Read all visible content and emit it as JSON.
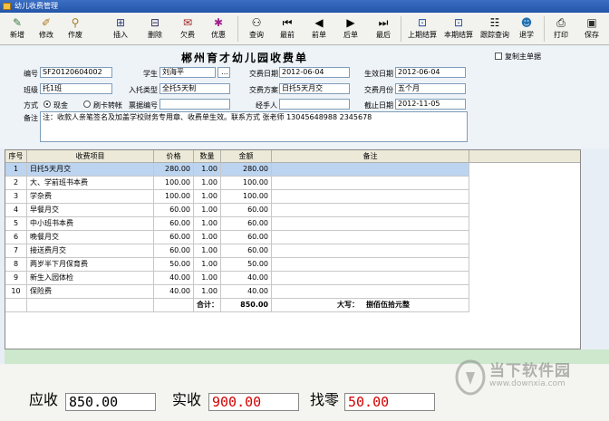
{
  "window": {
    "title": "幼儿收费管理"
  },
  "toolbar": {
    "items": [
      {
        "label": "新增",
        "icon": "new-icon"
      },
      {
        "label": "修改",
        "icon": "edit-icon"
      },
      {
        "label": "作废",
        "icon": "void-icon"
      },
      {
        "label": "插入",
        "icon": "insert-icon"
      },
      {
        "label": "删除",
        "icon": "delete-icon"
      },
      {
        "label": "欠费",
        "icon": "arrears-icon"
      },
      {
        "label": "优惠",
        "icon": "discount-icon"
      },
      {
        "label": "查询",
        "icon": "search-icon"
      },
      {
        "label": "最前",
        "icon": "first-icon"
      },
      {
        "label": "前单",
        "icon": "prev-icon"
      },
      {
        "label": "后单",
        "icon": "next-icon"
      },
      {
        "label": "最后",
        "icon": "last-icon"
      },
      {
        "label": "上期结算",
        "icon": "prev-settle-icon"
      },
      {
        "label": "本期结算",
        "icon": "cur-settle-icon"
      },
      {
        "label": "跟踪查询",
        "icon": "track-icon"
      },
      {
        "label": "退学",
        "icon": "withdraw-icon"
      },
      {
        "label": "打印",
        "icon": "print-icon"
      },
      {
        "label": "保存",
        "icon": "save-icon"
      }
    ]
  },
  "form": {
    "title": "郴州育才幼儿园收费单",
    "copy_label": "复制主单据",
    "fields": {
      "code_label": "编号",
      "code": "SF20120604002",
      "student_label": "学生",
      "student": "刘海平",
      "fee_date_label": "交费日期",
      "fee_date": "2012-06-04",
      "effective_label": "生效日期",
      "effective": "2012-06-04",
      "class_label": "班级",
      "class": "托1班",
      "enroll_label": "入托类型",
      "enroll": "全托5天制",
      "plan_label": "交费方案",
      "plan": "日托5天月交",
      "month_label": "交费月份",
      "month": "五个月",
      "method_label": "方式",
      "cash": "现金",
      "card": "刷卡转帐",
      "ticket_label": "票据编号",
      "ticket": "",
      "handler_label": "经手人",
      "handler": "",
      "deadline_label": "截止日期",
      "deadline": "2012-11-05",
      "remark_label": "备注",
      "remark": "注：收款人亲笔签名及加盖学校财务专用章、收费单生效。联系方式 张老师 13045648988 2345678"
    }
  },
  "grid": {
    "headers": [
      "序号",
      "收费项目",
      "价格",
      "数量",
      "金额",
      "备注"
    ],
    "rows": [
      [
        "1",
        "日托5天月交",
        "280.00",
        "1.00",
        "280.00",
        ""
      ],
      [
        "2",
        "大、学前班书本费",
        "100.00",
        "1.00",
        "100.00",
        ""
      ],
      [
        "3",
        "学杂费",
        "100.00",
        "1.00",
        "100.00",
        ""
      ],
      [
        "4",
        "早餐月交",
        "60.00",
        "1.00",
        "60.00",
        ""
      ],
      [
        "5",
        "中小班书本费",
        "60.00",
        "1.00",
        "60.00",
        ""
      ],
      [
        "6",
        "晚餐月交",
        "60.00",
        "1.00",
        "60.00",
        ""
      ],
      [
        "7",
        "接送费月交",
        "60.00",
        "1.00",
        "60.00",
        ""
      ],
      [
        "8",
        "两岁半下月保育费",
        "50.00",
        "1.00",
        "50.00",
        ""
      ],
      [
        "9",
        "新生入园体检",
        "40.00",
        "1.00",
        "40.00",
        ""
      ],
      [
        "10",
        "保险费",
        "40.00",
        "1.00",
        "40.00",
        ""
      ]
    ],
    "total_label": "合计：",
    "total": "850.00",
    "capital_label": "大写：",
    "capital": "捌佰伍拾元整"
  },
  "summary": {
    "due_label": "应收",
    "due": "850.00",
    "paid_label": "实收",
    "paid": "900.00",
    "change_label": "找零",
    "change": "50.00"
  },
  "watermark": {
    "text": "当下软件园",
    "url": "www.downxia.com"
  }
}
